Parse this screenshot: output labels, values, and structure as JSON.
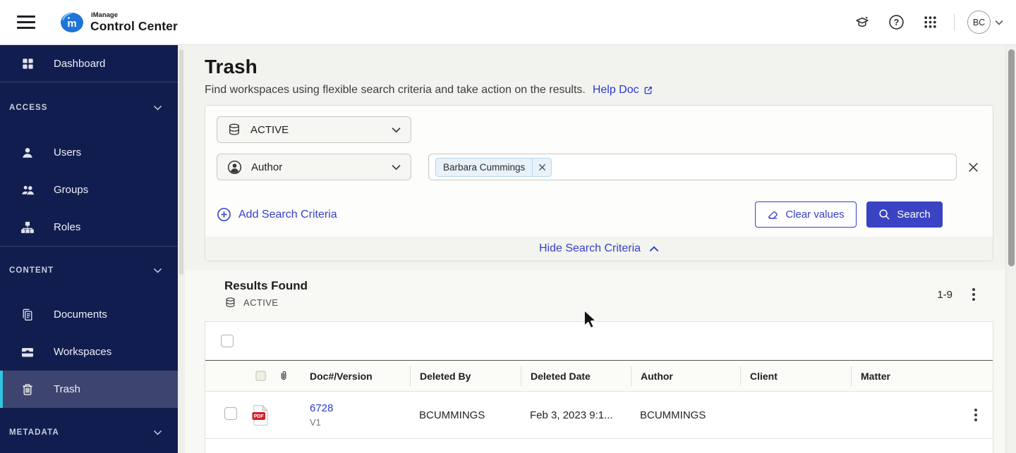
{
  "topbar": {
    "brand_small": "iManage",
    "brand_main": "Control Center",
    "avatar_initials": "BC"
  },
  "sidebar": {
    "dashboard_label": "Dashboard",
    "access_label": "ACCESS",
    "users_label": "Users",
    "groups_label": "Groups",
    "roles_label": "Roles",
    "content_label": "CONTENT",
    "documents_label": "Documents",
    "workspaces_label": "Workspaces",
    "trash_label": "Trash",
    "metadata_label": "METADATA"
  },
  "page": {
    "title": "Trash",
    "subtitle": "Find workspaces using flexible search criteria and take action on the results.",
    "help_link_label": "Help Doc"
  },
  "search": {
    "scope_selected": "ACTIVE",
    "criteria_field_selected": "Author",
    "criteria_chip": "Barbara Cummings",
    "add_criteria_label": "Add Search Criteria",
    "clear_values_label": "Clear values",
    "search_label": "Search",
    "hide_criteria_label": "Hide Search Criteria"
  },
  "results": {
    "header": "Results Found",
    "scope": "ACTIVE",
    "range": "1-9"
  },
  "table": {
    "columns": {
      "doc": "Doc#/Version",
      "deleted_by": "Deleted By",
      "deleted_date": "Deleted Date",
      "author": "Author",
      "client": "Client",
      "matter": "Matter"
    },
    "row1": {
      "doc_number": "6728",
      "version": "V1",
      "file_type": "PDF",
      "deleted_by": "BCUMMINGS",
      "deleted_date": "Feb 3, 2023 9:1...",
      "author": "BCUMMINGS",
      "client": "",
      "matter": ""
    }
  },
  "colors": {
    "sidebar_bg": "#121d4f",
    "sidebar_selected_bg": "#3e4470",
    "selected_accent": "#2fc4e0",
    "primary_button_blue": "#3a43c4",
    "link_blue": "#2b3ace",
    "chip_bg": "#e7f2fa",
    "pdf_red": "#cc2229"
  }
}
